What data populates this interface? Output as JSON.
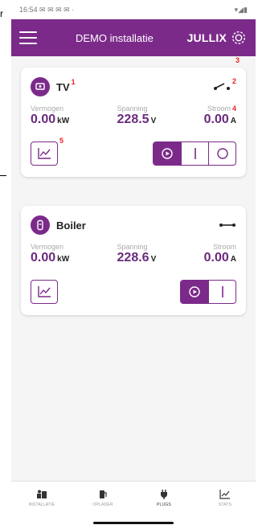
{
  "outer": {
    "label": "r"
  },
  "statusbar": {
    "time": "16:54",
    "left_icons": "✉ ✉ ✉ ✉ ·",
    "right_icons": "▾◢▮"
  },
  "appbar": {
    "title": "DEMO installatie",
    "brand": "JULLIX"
  },
  "devices": [
    {
      "name": "TV",
      "markers": {
        "name": "1",
        "switch": "2",
        "stroom": "4",
        "chart": "5",
        "mode": "3"
      },
      "metrics": [
        {
          "label": "Vermogen",
          "value": "0.00",
          "unit": "kW"
        },
        {
          "label": "Spanning",
          "value": "228.5",
          "unit": "V"
        },
        {
          "label": "Stroom",
          "value": "0.00",
          "unit": "A"
        }
      ],
      "switch_state": "off",
      "mode": "auto"
    },
    {
      "name": "Boiler",
      "metrics": [
        {
          "label": "Vermogen",
          "value": "0.00",
          "unit": "kW"
        },
        {
          "label": "Spanning",
          "value": "228.6",
          "unit": "V"
        },
        {
          "label": "Stroom",
          "value": "0.00",
          "unit": "A"
        }
      ],
      "switch_state": "on",
      "mode": "auto"
    }
  ],
  "bottom_nav": [
    {
      "label": "INSTALLATIE",
      "icon": "installation-icon"
    },
    {
      "label": "OPLADER",
      "icon": "charger-icon"
    },
    {
      "label": "PLUGS",
      "icon": "plug-icon",
      "active": true
    },
    {
      "label": "STATS",
      "icon": "stats-icon"
    }
  ],
  "colors": {
    "accent": "#7b2a8a",
    "marker": "#ee2222"
  }
}
